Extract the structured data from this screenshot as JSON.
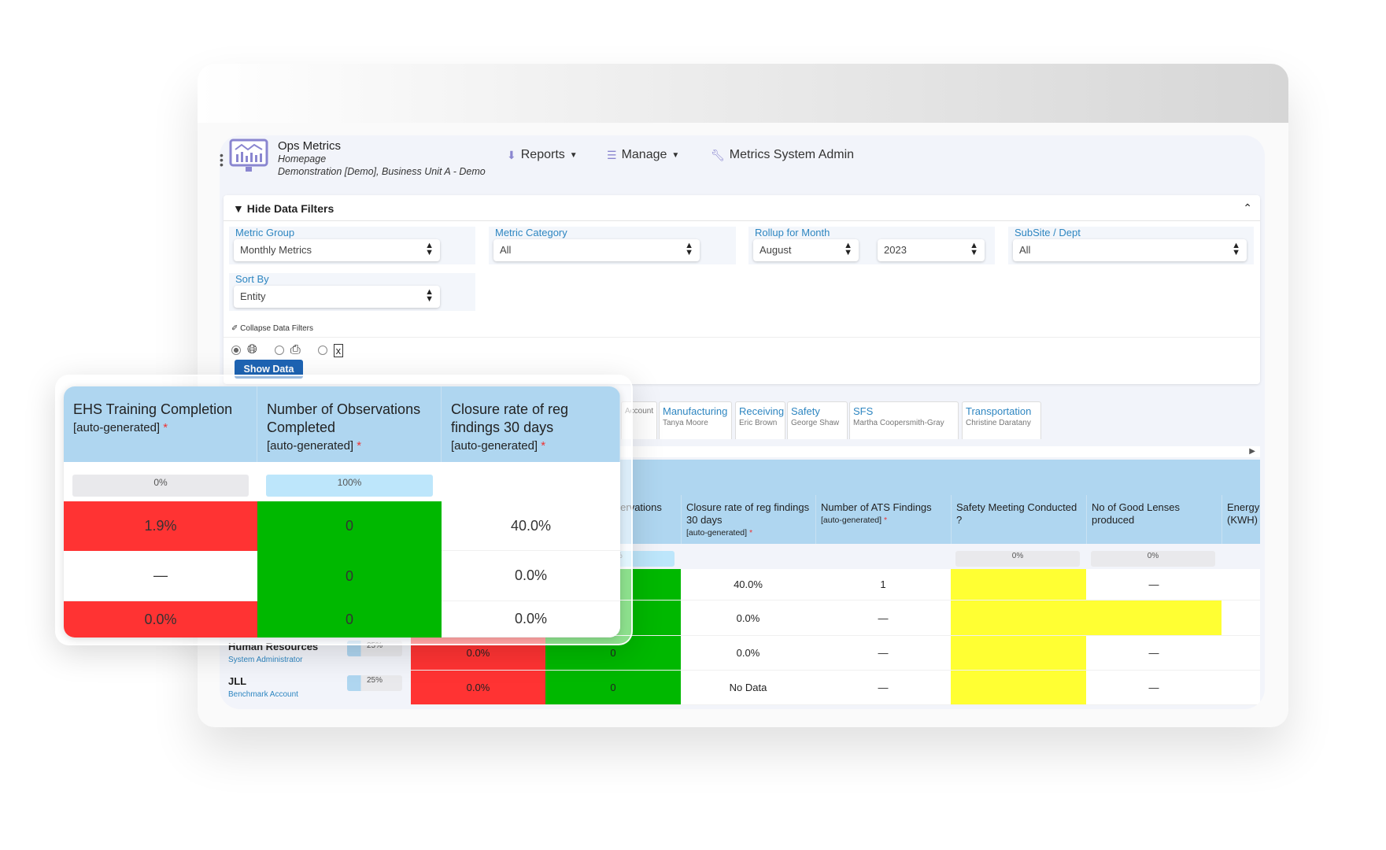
{
  "app": {
    "title": "Ops Metrics",
    "page": "Homepage",
    "context": "Demonstration [Demo], Business Unit A - Demo",
    "icon": "monitor-chart-icon"
  },
  "nav": {
    "reports": "Reports",
    "manage": "Manage",
    "admin": "Metrics System Admin"
  },
  "filters": {
    "toggle_label": "Hide Data Filters",
    "metric_group": {
      "label": "Metric Group",
      "value": "Monthly Metrics"
    },
    "metric_category": {
      "label": "Metric Category",
      "value": "All"
    },
    "rollup": {
      "label": "Rollup for Month",
      "month": "August",
      "year": "2023"
    },
    "subsite": {
      "label": "SubSite / Dept",
      "value": "All"
    },
    "sort_by": {
      "label": "Sort By",
      "value": "Entity"
    },
    "collapse_label": "Collapse Data Filters",
    "output_options": [
      "web",
      "print",
      "excel"
    ],
    "selected_output": "web",
    "show_button": "Show Data"
  },
  "tabs": [
    {
      "label": "",
      "person": "Account"
    },
    {
      "label": "Manufacturing",
      "person": "Tanya Moore"
    },
    {
      "label": "Receiving",
      "person": "Eric Brown"
    },
    {
      "label": "Safety",
      "person": "George Shaw"
    },
    {
      "label": "SFS",
      "person": "Martha Coopersmith-Gray"
    },
    {
      "label": "Transportation",
      "person": "Christine Daratany"
    }
  ],
  "table": {
    "auto_label": "[auto-generated]",
    "columns": [
      {
        "title": "EHS Training Completion",
        "auto": true,
        "progress": "0%",
        "progress_color": "#e9e9ec"
      },
      {
        "title": "Number of Observations Completed",
        "auto": true,
        "progress": "100%",
        "progress_color": "#bde6fb"
      },
      {
        "title": "Closure rate of reg findings 30 days",
        "auto": true,
        "progress": "",
        "progress_color": ""
      },
      {
        "title": "Number of ATS Findings",
        "auto": true,
        "progress": "",
        "progress_color": ""
      },
      {
        "title": "Safety Meeting Conducted ?",
        "auto": false,
        "progress": "0%",
        "progress_color": "#e9e9ec"
      },
      {
        "title": "No of Good Lenses produced",
        "auto": false,
        "progress": "0%",
        "progress_color": "#e9e9ec"
      },
      {
        "title": "Energy (KWH)",
        "auto": false,
        "progress": "",
        "progress_color": ""
      }
    ],
    "rows": [
      {
        "entity": "",
        "role": "",
        "completion": "",
        "values": [
          "1.9%",
          "0",
          "40.0%",
          "1",
          "",
          "—",
          ""
        ],
        "colors": [
          "#ff3333",
          "#00b800",
          "",
          "",
          "#ffff33",
          "",
          ""
        ]
      },
      {
        "entity": "",
        "role": "",
        "completion": "",
        "values": [
          "—",
          "0",
          "0.0%",
          "—",
          "",
          "",
          ""
        ],
        "colors": [
          "",
          "#00b800",
          "",
          "",
          "#ffff33",
          "#ffff33",
          ""
        ]
      },
      {
        "entity": "Human Resources",
        "role": "System Administrator",
        "completion": "25%",
        "values": [
          "0.0%",
          "0",
          "0.0%",
          "—",
          "",
          "—",
          ""
        ],
        "colors": [
          "#ff3333",
          "#00b800",
          "",
          "",
          "#ffff33",
          "",
          ""
        ]
      },
      {
        "entity": "JLL",
        "role": "Benchmark Account",
        "completion": "25%",
        "values": [
          "0.0%",
          "0",
          "No Data",
          "—",
          "",
          "—",
          ""
        ],
        "colors": [
          "#ff3333",
          "#00b800",
          "",
          "",
          "#ffff33",
          "",
          ""
        ]
      }
    ]
  }
}
